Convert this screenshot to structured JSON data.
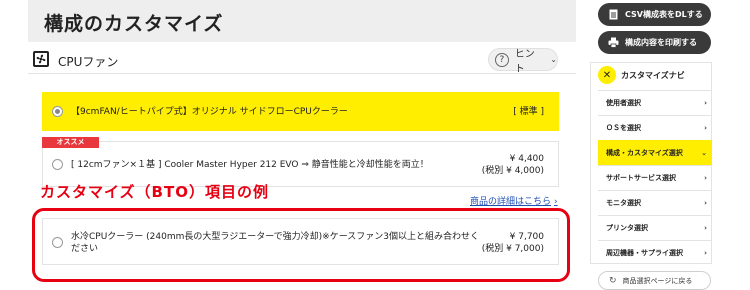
{
  "page_title": "構成のカスタマイズ",
  "section": {
    "title": "CPUファン",
    "icon": "fan-icon",
    "hint_label": "ヒント"
  },
  "options": [
    {
      "name": "【9cmFAN/ヒートパイプ式】オリジナル サイドフローCPUクーラー",
      "price": "[ 標準 ]",
      "price_tax": "",
      "selected": true
    },
    {
      "badge": "オススメ",
      "name": "[ 12cmファン×１基 ] Cooler Master Hyper 212 EVO ⇒ 静音性能と冷却性能を両立！",
      "price": "¥ 4,400",
      "price_tax": "(税別 ¥ 4,000)",
      "selected": false
    },
    {
      "name": "水冷CPUクーラー (240mm長の大型ラジエーターで強力冷却)※ケースファン3個以上と組み合わせく",
      "name_line2": "ださい",
      "price": "¥ 7,700",
      "price_tax": "(税別 ¥ 7,000)",
      "selected": false
    }
  ],
  "annotation": "カスタマイズ（BTO）項目の例",
  "details_link": "商品の詳細はこちら",
  "sidebar": {
    "csv_button": "CSV構成表をDLする",
    "print_button": "構成内容を印刷する",
    "nav_title": "カスタマイズナビ",
    "nav_items": [
      {
        "label": "使用者選択",
        "active": false
      },
      {
        "label": "ＯＳを選択",
        "active": false
      },
      {
        "label": "構成・カスタマイズ選択",
        "active": true
      },
      {
        "label": "サポートサービス選択",
        "active": false
      },
      {
        "label": "モニタ選択",
        "active": false
      },
      {
        "label": "プリンタ選択",
        "active": false
      },
      {
        "label": "周辺機器・サプライ選択",
        "active": false
      }
    ],
    "back_button": "商品選択ページに戻る"
  },
  "colors": {
    "accent_yellow": "#ffee00",
    "highlight_red": "#e60012",
    "badge_red": "#e8383d",
    "dark_button": "#3a3a3a"
  }
}
